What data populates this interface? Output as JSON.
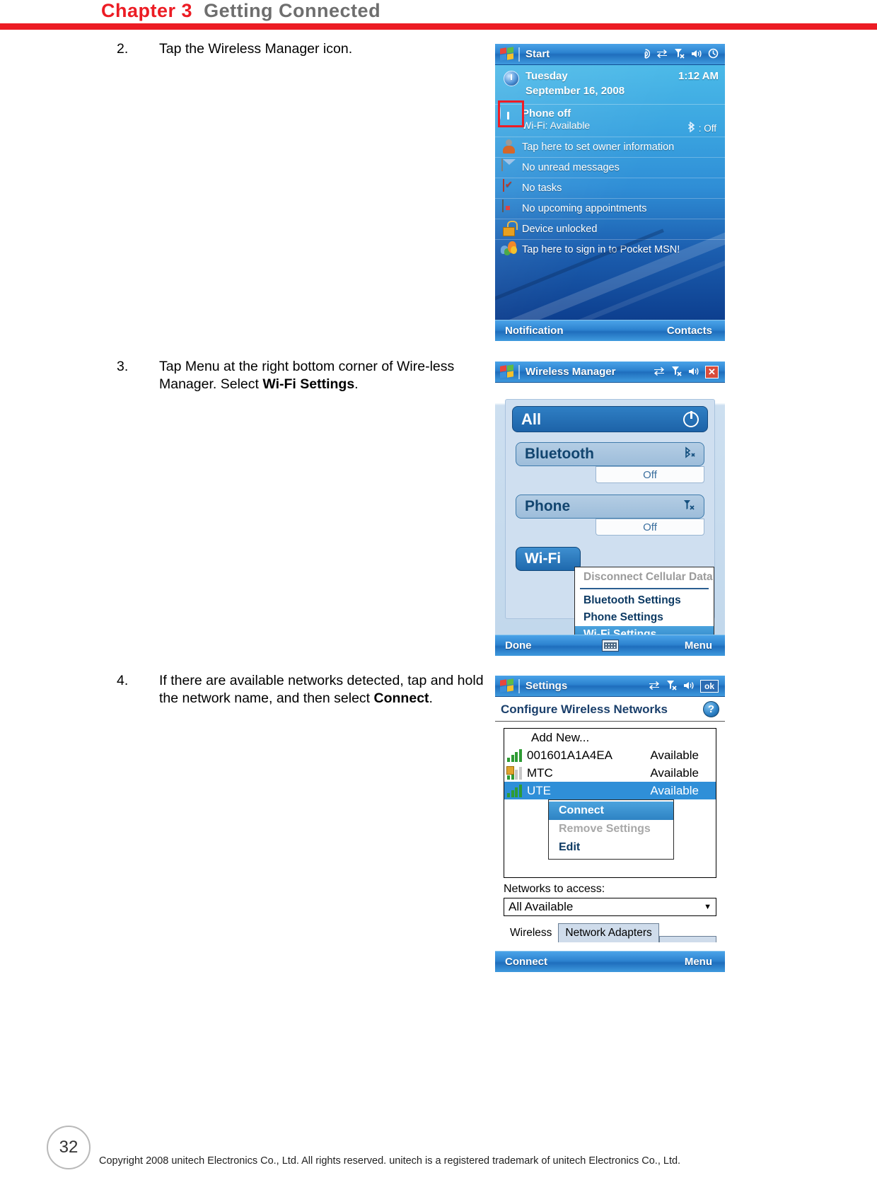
{
  "header": {
    "chapter": "Chapter 3",
    "subtitle": "Getting Connected"
  },
  "steps": [
    {
      "number": "2.",
      "text_before": "Tap the Wireless Manager icon.",
      "bold": "",
      "text_after": ""
    },
    {
      "number": "3.",
      "text_before": "Tap Menu at the right bottom corner of Wire-less Manager. Select ",
      "bold": "Wi-Fi Settings",
      "text_after": "."
    },
    {
      "number": "4.",
      "text_before": "If there are available networks detected, tap and hold the network name, and then select ",
      "bold": "Connect",
      "text_after": "."
    }
  ],
  "today_screen": {
    "titlebar": {
      "start_label": "Start",
      "icons": [
        "wifi-signal-icon",
        "connectivity-icon",
        "phone-off-icon",
        "volume-icon",
        "sync-icon"
      ]
    },
    "date": {
      "day": "Tuesday",
      "full_date": "September 16, 2008",
      "time": "1:12 AM"
    },
    "rows": [
      {
        "icon": "signal-icon",
        "primary": "Phone off",
        "secondary": "Wi-Fi: Available",
        "right": ": Off",
        "right_icon": "bluetooth-icon"
      },
      {
        "icon": "person-icon",
        "primary": "Tap here to set owner information",
        "secondary": "",
        "right": ""
      },
      {
        "icon": "envelope-icon",
        "primary": "No unread messages",
        "secondary": "",
        "right": ""
      },
      {
        "icon": "clipboard-icon",
        "primary": "No tasks",
        "secondary": "",
        "right": ""
      },
      {
        "icon": "calendar-icon",
        "primary": "No upcoming appointments",
        "secondary": "",
        "right": ""
      },
      {
        "icon": "lock-icon",
        "primary": "Device unlocked",
        "secondary": "",
        "right": ""
      },
      {
        "icon": "msn-butterfly-icon",
        "primary": "Tap here to sign in to Pocket MSN!",
        "secondary": "",
        "right": ""
      }
    ],
    "softbar": {
      "left": "Notification",
      "right": "Contacts"
    }
  },
  "wireless_manager": {
    "titlebar": {
      "title": "Wireless Manager",
      "close_label": "✕"
    },
    "all_row": {
      "label": "All",
      "icon": "power-icon"
    },
    "items": [
      {
        "label": "Bluetooth",
        "icon": "bluetooth-off-icon",
        "status": "Off"
      },
      {
        "label": "Phone",
        "icon": "phone-off-icon",
        "status": "Off"
      },
      {
        "label": "Wi-Fi",
        "icon": "wifi-icon",
        "status": ""
      }
    ],
    "menu": [
      {
        "label": "Disconnect Cellular Data",
        "state": "disabled"
      },
      {
        "label": "Bluetooth Settings",
        "state": "normal"
      },
      {
        "label": "Phone Settings",
        "state": "normal"
      },
      {
        "label": "Wi-Fi Settings",
        "state": "highlighted"
      }
    ],
    "softbar": {
      "left": "Done",
      "center": "keyboard-icon",
      "right": "Menu"
    }
  },
  "settings_screen": {
    "titlebar": {
      "title": "Settings",
      "ok_label": "ok"
    },
    "page_title": "Configure Wireless Networks",
    "help_icon": "?",
    "networks": [
      {
        "name": "Add New...",
        "status": "",
        "icon": "none",
        "selected": false
      },
      {
        "name": "001601A1A4EA",
        "status": "Available",
        "icon": "signal-bars-icon",
        "selected": false
      },
      {
        "name": "MTC",
        "status": "Available",
        "icon": "signal-bars-locked-icon",
        "selected": false
      },
      {
        "name": "UTE",
        "status": "Available",
        "icon": "signal-bars-icon",
        "selected": true
      }
    ],
    "context_menu": [
      {
        "label": "Connect",
        "state": "highlighted"
      },
      {
        "label": "Remove Settings",
        "state": "disabled"
      },
      {
        "label": "Edit",
        "state": "normal"
      }
    ],
    "networks_to_access_label": "Networks to access:",
    "networks_to_access_value": "All Available",
    "tabs": [
      {
        "label": "Wireless",
        "active": false
      },
      {
        "label": "Network Adapters",
        "active": true
      }
    ],
    "softbar": {
      "left": "Connect",
      "right": "Menu"
    }
  },
  "footer": {
    "page_number": "32",
    "copyright": "Copyright 2008 unitech Electronics Co., Ltd. All rights reserved. unitech is a registered trademark of unitech Electronics Co., Ltd."
  }
}
